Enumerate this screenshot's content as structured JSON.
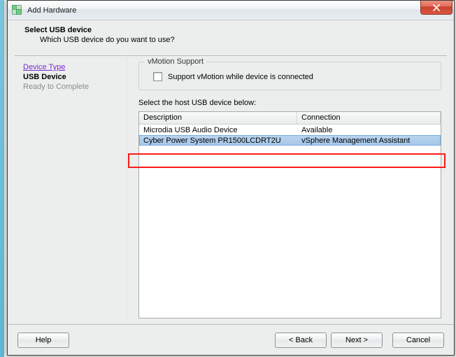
{
  "window": {
    "title": "Add Hardware"
  },
  "header": {
    "title": "Select USB device",
    "subtitle": "Which USB device do you want to use?"
  },
  "wizard": {
    "prev": "Device Type",
    "current": "USB Device",
    "next": "Ready to Complete"
  },
  "vmotion": {
    "legend": "vMotion Support",
    "checkbox_label": "Support vMotion while device is connected",
    "checked": false
  },
  "device_list": {
    "instruction": "Select the host USB device below:",
    "columns": {
      "desc": "Description",
      "conn": "Connection"
    },
    "rows": [
      {
        "desc": "Microdia USB Audio Device",
        "conn": "Available",
        "selected": false
      },
      {
        "desc": "Cyber Power System PR1500LCDRT2U",
        "conn": "vSphere Management Assistant",
        "selected": true
      }
    ]
  },
  "buttons": {
    "help": "Help",
    "back": "< Back",
    "next": "Next >",
    "cancel": "Cancel"
  }
}
